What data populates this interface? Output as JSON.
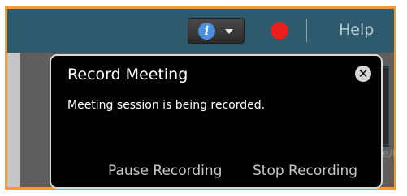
{
  "toolbar": {
    "info_icon": "info-icon",
    "dropdown_icon": "chevron-down-icon",
    "record_icon": "record-dot-icon",
    "help_label": "Help"
  },
  "background": {
    "partial_label": "Share/N"
  },
  "popup": {
    "title": "Record Meeting",
    "message": "Meeting session is being recorded.",
    "close_icon": "close-icon",
    "pause_label": "Pause Recording",
    "stop_label": "Stop Recording"
  },
  "colors": {
    "frame_border": "#f39a35",
    "toolbar_bg": "#2d5a6c",
    "record_red": "#ec1d1d",
    "info_blue": "#4a8fe2",
    "popup_bg": "#000000"
  }
}
